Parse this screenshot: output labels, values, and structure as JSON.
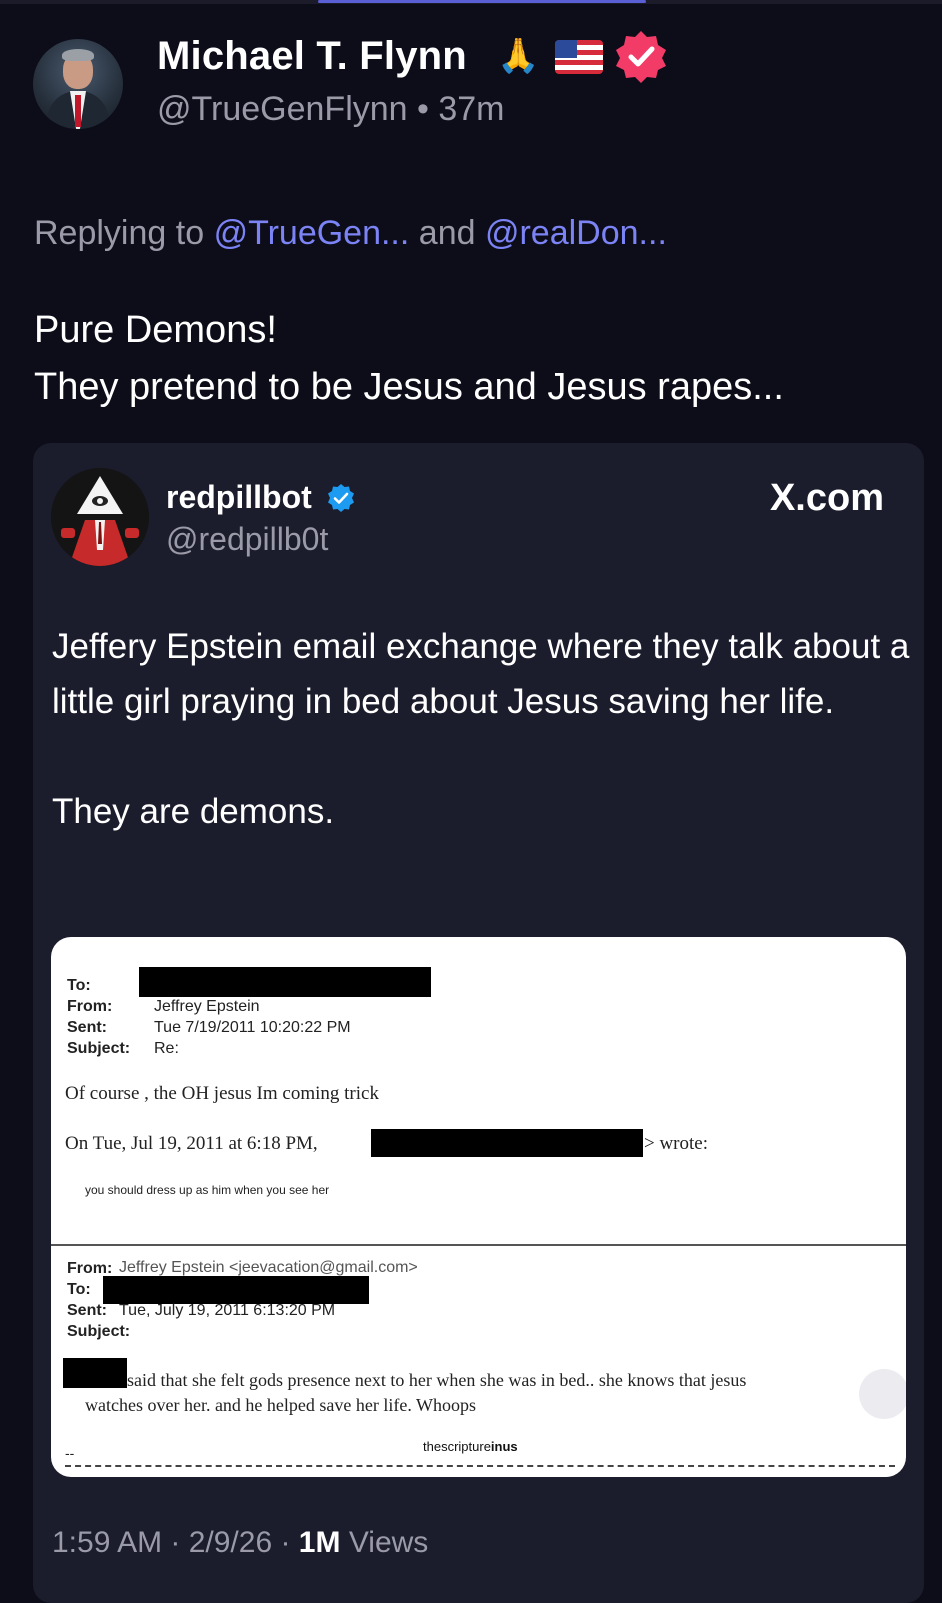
{
  "post": {
    "author_name": "Michael T. Flynn",
    "author_emoji": "🙏",
    "author_handle": "@TrueGenFlynn",
    "time_ago": "37m",
    "handle_time": "@TrueGenFlynn • 37m",
    "replying_prefix": "Replying to",
    "reply_mention_1": "@TrueGen...",
    "reply_and": "and",
    "reply_mention_2": "@realDon...",
    "text_line1": "Pure Demons!",
    "text_line2": "They pretend to be Jesus and Jesus rapes..."
  },
  "quote": {
    "author_name": "redpillbot",
    "author_handle": "@redpillb0t",
    "source": "X.com",
    "text_p1": "Jeffery Epstein email exchange where they talk about  a little girl praying in bed about Jesus saving her life.",
    "text_p2": "They are demons.",
    "meta_time": "1:59 AM · 2/9/26 · ",
    "meta_views_count": "1M",
    "meta_views_label": " Views"
  },
  "email": {
    "to_label": "To:",
    "from_label": "From:",
    "sent_label": "Sent:",
    "subject_label": "Subject:",
    "from_value": "Jeffrey Epstein",
    "sent_value": "Tue 7/19/2011 10:20:22 PM",
    "subject_value": "Re:",
    "body_line1": "Of course  ,  the OH jesus  Im coming trick",
    "quote_header_start": "On Tue, Jul 19, 2011 at 6:18 PM,",
    "quote_header_end": "> wrote:",
    "quoted_line": "you should dress up as him when you see her",
    "from2_label": "From:",
    "from2_value": "Jeffrey Epstein <jeevacation@gmail.com>",
    "to2_label": "To:",
    "sent2_label": "Sent:",
    "sent2_value": "Tue, July 19, 2011 6:13:20 PM",
    "subject2_label": "Subject:",
    "body2_line1": "said that she felt gods presence next to her when she was in bed..  she knows that jesus",
    "body2_line2": "watches over her.  and he helped save her life.      Whoops",
    "signature": "--",
    "watermark_prefix": "thescripture",
    "watermark_bold": "inus"
  },
  "colors": {
    "background": "#0d0d1a",
    "card": "#1b1c2c",
    "mention": "#7b83f5",
    "muted": "#9a9aa8",
    "verified_pink": "#f23c67",
    "verified_blue": "#1d9bf0"
  }
}
